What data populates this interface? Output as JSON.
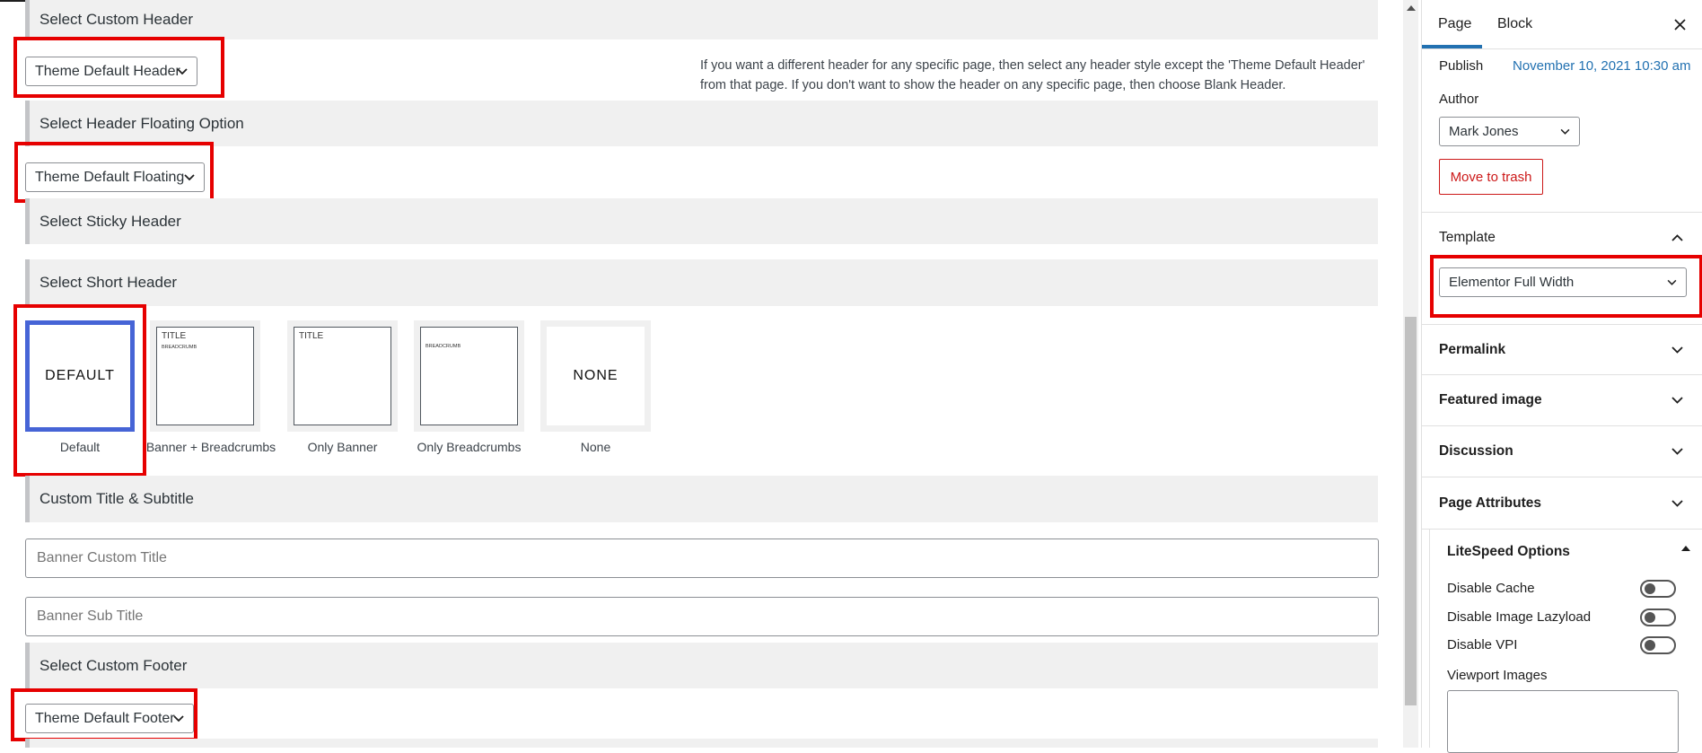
{
  "sections": {
    "custom_header": "Select Custom Header",
    "floating": "Select Header Floating Option",
    "sticky": "Select Sticky Header",
    "short_header": "Select Short Header",
    "title_subtitle": "Custom Title & Subtitle",
    "custom_footer": "Select Custom Footer"
  },
  "selects": {
    "header": "Theme Default Header",
    "floating": "Theme Default Floating",
    "footer": "Theme Default Footer"
  },
  "help_text": "If you want a different header for any specific page, then select any header style except the 'Theme Default Header' from that page. If you don't want to show the header on any specific page, then choose Blank Header.",
  "header_options": [
    {
      "card": "DEFAULT",
      "label": "Default"
    },
    {
      "title": "TITLE",
      "sub": "BREADCRUMB",
      "label": "Banner + Breadcrumbs"
    },
    {
      "title": "TITLE",
      "label": "Only Banner"
    },
    {
      "sub": "BREADCRUMB",
      "label": "Only Breadcrumbs"
    },
    {
      "card": "NONE",
      "label": "None"
    }
  ],
  "inputs": {
    "banner_title_placeholder": "Banner Custom Title",
    "banner_subtitle_placeholder": "Banner Sub Title"
  },
  "sidebar": {
    "tabs": [
      "Page",
      "Block"
    ],
    "publish_label": "Publish",
    "publish_date": "November 10, 2021 10:30 am",
    "author_label": "Author",
    "author_value": "Mark Jones",
    "trash_label": "Move to trash",
    "template_label": "Template",
    "template_value": "Elementor Full Width",
    "panels": [
      "Permalink",
      "Featured image",
      "Discussion",
      "Page Attributes"
    ],
    "litespeed": {
      "title": "LiteSpeed Options",
      "options": [
        "Disable Cache",
        "Disable Image Lazyload",
        "Disable VPI"
      ],
      "viewport_label": "Viewport Images"
    }
  },
  "colors": {
    "highlight_box": "#e60000",
    "link_blue": "#2271b1",
    "selected_card": "#4664d6",
    "trash_red": "#cc1818"
  }
}
